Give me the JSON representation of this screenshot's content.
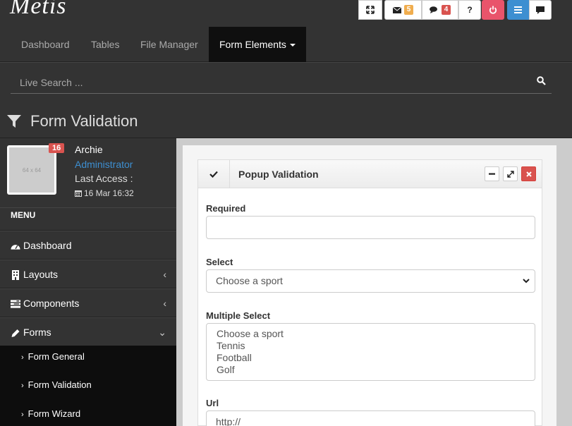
{
  "app": {
    "logo": "Metis"
  },
  "toolbar": {
    "mail_count": "5",
    "comments_count": "4",
    "help_label": "?",
    "colors": {
      "mail_badge": "#f0ad4e",
      "comment_badge": "#d9534f",
      "power": "#e9546b",
      "menu": "#3d8fd1"
    }
  },
  "nav": {
    "items": [
      {
        "label": "Dashboard"
      },
      {
        "label": "Tables"
      },
      {
        "label": "File Manager"
      },
      {
        "label": "Form Elements"
      }
    ]
  },
  "search": {
    "placeholder": "Live Search ..."
  },
  "page": {
    "title": "Form Validation"
  },
  "user": {
    "avatar_text": "64 x 64",
    "badge": "16",
    "name": "Archie",
    "role": "Administrator",
    "access_label": "Last Access :",
    "access_date": "16 Mar 16:32"
  },
  "sidebar": {
    "menu_label": "MENU",
    "items": [
      {
        "label": "Dashboard"
      },
      {
        "label": "Layouts"
      },
      {
        "label": "Components"
      },
      {
        "label": "Forms"
      }
    ],
    "subitems": [
      {
        "label": "Form General"
      },
      {
        "label": "Form Validation"
      },
      {
        "label": "Form Wizard"
      }
    ]
  },
  "panel": {
    "title": "Popup Validation",
    "fields": {
      "required_label": "Required",
      "select_label": "Select",
      "select_value": "Choose a sport",
      "multi_label": "Multiple Select",
      "multi_options": [
        "Choose a sport",
        "Tennis",
        "Football",
        "Golf"
      ],
      "url_label": "Url",
      "url_value": "http://"
    }
  }
}
